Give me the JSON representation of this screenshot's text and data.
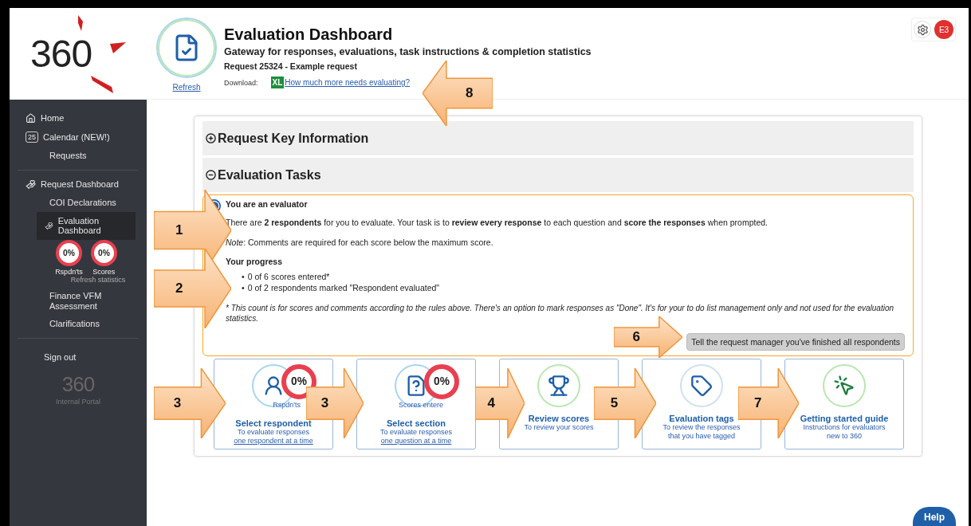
{
  "logo": {
    "text": "360"
  },
  "header": {
    "title": "Evaluation Dashboard",
    "subtitle": "Gateway for responses, evaluations, task instructions & completion statistics",
    "request": "Request 25324 - Example request",
    "refresh": "Refresh",
    "download_label": "Download:",
    "download_badge": "XL",
    "download_link": "How much more needs evaluating?"
  },
  "user": {
    "initials": "E3"
  },
  "sidebar": {
    "items": [
      {
        "kind": "home",
        "label": "Home",
        "selected": false
      },
      {
        "kind": "calendar",
        "label": "Calendar (NEW!)",
        "badge": "25",
        "selected": false
      },
      {
        "kind": "link",
        "label": "Requests",
        "selected": false
      },
      {
        "kind": "divider"
      },
      {
        "kind": "dashboard",
        "label": "Request Dashboard",
        "selected": false
      },
      {
        "kind": "link",
        "label": "COI Declarations",
        "selected": false
      },
      {
        "kind": "evaluation",
        "label": "Evaluation Dashboard",
        "selected": true
      },
      {
        "kind": "stats",
        "stats": [
          {
            "value": "0%",
            "label": "Rspdn'ts"
          },
          {
            "value": "0%",
            "label": "Scores"
          }
        ],
        "refresh": "Refresh statistics"
      },
      {
        "kind": "link",
        "label": "Finance VFM Assessment",
        "selected": false
      },
      {
        "kind": "link",
        "label": "Clarifications",
        "selected": false
      },
      {
        "kind": "divider"
      },
      {
        "kind": "signout",
        "label": "Sign out",
        "selected": false
      }
    ],
    "footer_logo": "360",
    "footer_caption": "Internal Portal"
  },
  "sections": [
    {
      "title": "Request Key Information",
      "expanded": false
    },
    {
      "title": "Evaluation Tasks",
      "expanded": true
    }
  ],
  "info": {
    "heading": "You are an evaluator",
    "text": "There are **2 respondents** for you to evaluate. Your task is to **review every response** to each question and **score the responses** when prompted.",
    "note": "*Note*: Comments are required for each score below the maximum score.",
    "progress_heading": "Your progress",
    "bullet": "•",
    "progress": [
      "0 of 6 scores entered*",
      "0 of 2 respondents marked \"Respondent evaluated\""
    ],
    "footnote": "* This count is for scores and comments according to the rules above. There's an option to mark responses as \"Done\". It's for your to do list management only and not used for the evaluation statistics.",
    "button": "Tell the request manager you've finished all respondents"
  },
  "tiles": [
    {
      "kind": "respondent",
      "title": "Select respondent",
      "text": "To evaluate responses ",
      "link": "one respondent at a time",
      "stat": {
        "value": "0%",
        "label": "Rspdn'ts"
      }
    },
    {
      "kind": "section",
      "title": "Select section",
      "text": "To evaluate responses ",
      "link": "one question at a time",
      "stat": {
        "value": "0%",
        "label": "Scores entere"
      }
    },
    {
      "kind": "review",
      "title": "Review scores",
      "text": "To review your scores"
    },
    {
      "kind": "tags",
      "title": "Evaluation tags",
      "text": "To review the responses that you have tagged"
    },
    {
      "kind": "guide",
      "title": "Getting started guide",
      "text": "Instructions for evaluators new to 360"
    }
  ],
  "callouts": [
    {
      "number": "8",
      "kind": "left"
    },
    {
      "number": "1",
      "kind": "right"
    },
    {
      "number": "2",
      "kind": "right"
    },
    {
      "number": "6",
      "kind": "right"
    },
    {
      "number": "3",
      "kind": "right"
    },
    {
      "number": "3",
      "kind": "right"
    },
    {
      "number": "4",
      "kind": "right"
    },
    {
      "number": "5",
      "kind": "right"
    },
    {
      "number": "7",
      "kind": "right"
    }
  ],
  "help": {
    "label": "Help"
  }
}
